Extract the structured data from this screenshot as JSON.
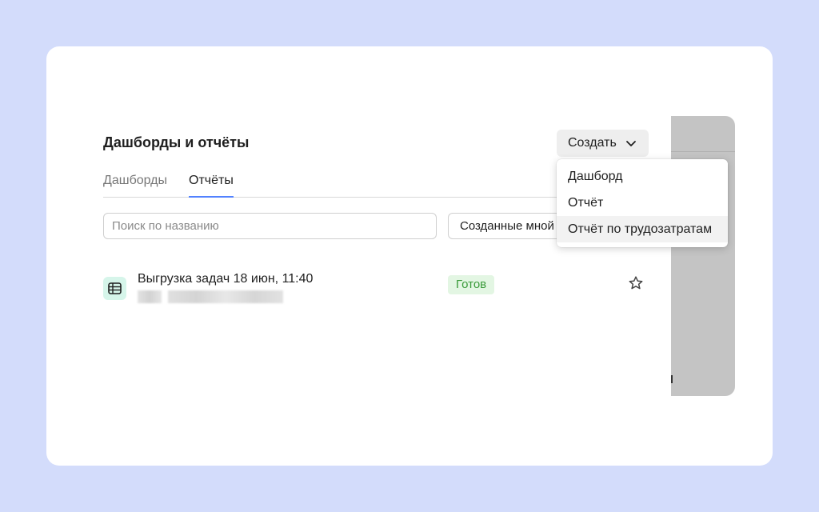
{
  "header": {
    "title": "Дашборды и отчёты",
    "create_label": "Создать"
  },
  "tabs": [
    {
      "label": "Дашборды",
      "active": false
    },
    {
      "label": "Отчёты",
      "active": true
    }
  ],
  "filters": {
    "search_placeholder": "Поиск по названию",
    "search_value": "",
    "owner_filter_label": "Созданные мной"
  },
  "reports": [
    {
      "title": "Выгрузка задач 18 июн, 11:40",
      "status": "Готов",
      "icon": "table-icon",
      "favorite": false
    }
  ],
  "create_menu": {
    "items": [
      {
        "label": "Дашборд"
      },
      {
        "label": "Отчёт"
      },
      {
        "label": "Отчёт по трудозатратам",
        "hovered": true
      }
    ]
  },
  "colors": {
    "background": "#d3dcfb",
    "accent": "#5282ff",
    "status_ready_bg": "#e3f6e3",
    "status_ready_text": "#3a9b3a",
    "icon_bg": "#d6f5ea"
  }
}
